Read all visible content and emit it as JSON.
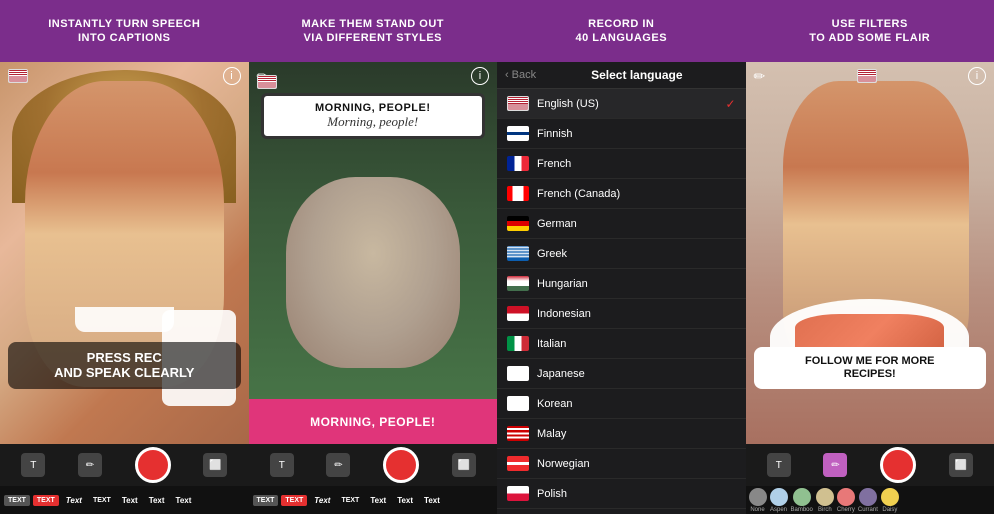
{
  "panels": [
    {
      "id": "panel1",
      "header": "INSTANTLY TURN SPEECH\nINTO CAPTIONS",
      "status": {
        "flag": "us",
        "info": "i"
      },
      "caption": "PRESS REC\nAND SPEAK CLEARLY",
      "controls": {
        "text_btn": "T",
        "pen_btn": "✏",
        "rec_btn": "",
        "camera_btn": "📷"
      },
      "text_styles": [
        "TEXT",
        "TEXT",
        "Text",
        "TEXT",
        "Text",
        "Text",
        "Text"
      ]
    },
    {
      "id": "panel2",
      "header": "MAKE THEM STAND OUT\nVIA DIFFERENT STYLES",
      "bubble_bold": "MORNING, PEOPLE!",
      "bubble_italic": "Morning, people!",
      "bottom_text": "MORNING, PEOPLE!",
      "controls": {
        "text_btn": "T",
        "pen_btn": "✏",
        "rec_btn": "",
        "camera_btn": "📷"
      },
      "text_styles": [
        "TEXT",
        "TEXT",
        "Text",
        "TEXT",
        "Text",
        "Text",
        "Text"
      ]
    },
    {
      "id": "panel3",
      "header": "RECORD IN\n40 LANGUAGES",
      "nav": {
        "back": "Back",
        "title": "Select language"
      },
      "languages": [
        {
          "name": "English (US)",
          "flag": "us",
          "selected": true
        },
        {
          "name": "Finnish",
          "flag": "fi",
          "selected": false
        },
        {
          "name": "French",
          "flag": "fr",
          "selected": false
        },
        {
          "name": "French (Canada)",
          "flag": "ca",
          "selected": false
        },
        {
          "name": "German",
          "flag": "de",
          "selected": false
        },
        {
          "name": "Greek",
          "flag": "gr",
          "selected": false
        },
        {
          "name": "Hungarian",
          "flag": "hu",
          "selected": false
        },
        {
          "name": "Indonesian",
          "flag": "id",
          "selected": false
        },
        {
          "name": "Italian",
          "flag": "it",
          "selected": false
        },
        {
          "name": "Japanese",
          "flag": "jp",
          "selected": false
        },
        {
          "name": "Korean",
          "flag": "kr",
          "selected": false
        },
        {
          "name": "Malay",
          "flag": "my",
          "selected": false
        },
        {
          "name": "Norwegian",
          "flag": "no",
          "selected": false
        },
        {
          "name": "Polish",
          "flag": "pl",
          "selected": false
        }
      ]
    },
    {
      "id": "panel4",
      "header": "USE FILTERS\nTO ADD SOME FLAIR",
      "caption": "FOLLOW ME FOR MORE\nRECIPES!",
      "controls": {
        "text_btn": "T",
        "pen_btn": "✏",
        "rec_btn": "",
        "camera_btn": "📷"
      },
      "filters": [
        {
          "name": "None",
          "color": "#888"
        },
        {
          "name": "Aspen",
          "color": "#b0d0e8"
        },
        {
          "name": "Bamboo",
          "color": "#90c090"
        },
        {
          "name": "Birch",
          "color": "#d0c090"
        },
        {
          "name": "Cherry",
          "color": "#e87878"
        },
        {
          "name": "Currant",
          "color": "#8070a0"
        },
        {
          "name": "Daisy",
          "color": "#f0d050"
        }
      ]
    }
  ]
}
